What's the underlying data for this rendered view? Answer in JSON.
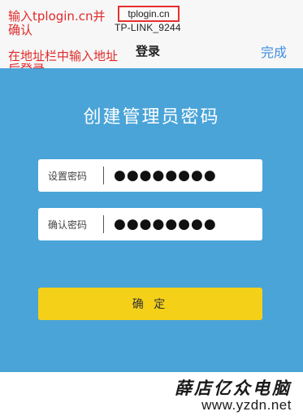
{
  "browser": {
    "url": "tplogin.cn",
    "network_name": "TP-LINK_9244"
  },
  "nav": {
    "title": "登录",
    "done_label": "完成"
  },
  "annotations": {
    "step1_line1": "输入tplogin.cn并",
    "step1_line2": "确认",
    "step2_line1": "在地址栏中输入地址",
    "step2_line2": "后登录"
  },
  "form": {
    "heading": "创建管理员密码",
    "password_label": "设置密码",
    "password_value": "●●●●●●●●",
    "confirm_label": "确认密码",
    "confirm_value": "●●●●●●●●",
    "submit_label": "确 定"
  },
  "watermark": {
    "brand": "薛店亿众电脑",
    "url": "www.yzdn.net"
  },
  "colors": {
    "main_bg": "#4aa4d8",
    "button_bg": "#f4d018",
    "link": "#3f8fe0",
    "annotation": "#e02a2a"
  }
}
